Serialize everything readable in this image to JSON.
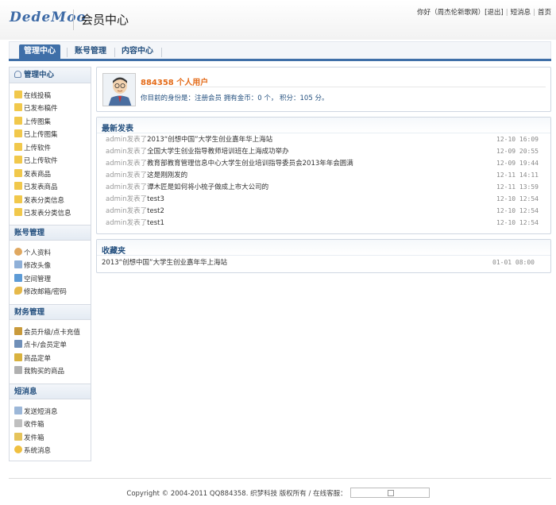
{
  "header": {
    "logo": "DedeMoo",
    "title": "会员中心",
    "greeting": "你好（周杰伦新歌网）",
    "logout": "[退出]",
    "messages": "短消息",
    "home": "首页"
  },
  "tabs": [
    {
      "label": "管理中心"
    },
    {
      "label": "账号管理"
    },
    {
      "label": "内容中心"
    }
  ],
  "sidebar": {
    "sections": [
      {
        "title": "管理中心",
        "items": [
          "在线投稿",
          "已发布稿件",
          "上传图集",
          "已上传图集",
          "上传软件",
          "已上传软件",
          "发表商品",
          "已发表商品",
          "发表分类信息",
          "已发表分类信息"
        ]
      },
      {
        "title": "账号管理",
        "items": [
          "个人资料",
          "修改头像",
          "空间管理",
          "修改邮箱/密码"
        ]
      },
      {
        "title": "财务管理",
        "items": [
          "会员升级/点卡充值",
          "点卡/会员定单",
          "商品定单",
          "我购买的商品"
        ]
      },
      {
        "title": "短消息",
        "items": [
          "发送短消息",
          "收件箱",
          "发件箱",
          "系统消息"
        ]
      }
    ]
  },
  "user": {
    "name": "884358 个人用户",
    "info": "你目前的身份是：注册会员 拥有金币：0 个， 积分：105 分。"
  },
  "latest": {
    "title": "最新发表",
    "rows": [
      {
        "who": "admin发表了",
        "title": "2013“创想中国”大学生创业嘉年华上海站",
        "date": "12-10 16:09"
      },
      {
        "who": "admin发表了",
        "title": "全国大学生创业指导教师培训班在上海成功举办",
        "date": "12-09 20:55"
      },
      {
        "who": "admin发表了",
        "title": "教育部教育管理信息中心大学生创业培训指导委员会2013年年会圆满",
        "date": "12-09 19:44"
      },
      {
        "who": "admin发表了",
        "title": "这是刚刚发的",
        "date": "12-11 14:11"
      },
      {
        "who": "admin发表了",
        "title": "谭木匠是如何将小梳子做成上市大公司的",
        "date": "12-11 13:59"
      },
      {
        "who": "admin发表了",
        "title": "test3",
        "date": "12-10 12:54"
      },
      {
        "who": "admin发表了",
        "title": "test2",
        "date": "12-10 12:54"
      },
      {
        "who": "admin发表了",
        "title": "test1",
        "date": "12-10 12:54"
      }
    ]
  },
  "favorites": {
    "title": "收藏夹",
    "rows": [
      {
        "title": "2013“创想中国”大学生创业嘉年华上海站",
        "date": "01-01 08:00"
      }
    ]
  },
  "footer": {
    "copyright": "Copyright © 2004-2011 QQ884358. 织梦科技 版权所有 / 在线客服："
  },
  "colors": {
    "accent": "#3f6fa8",
    "link": "#24507f",
    "highlight": "#e46a17"
  }
}
